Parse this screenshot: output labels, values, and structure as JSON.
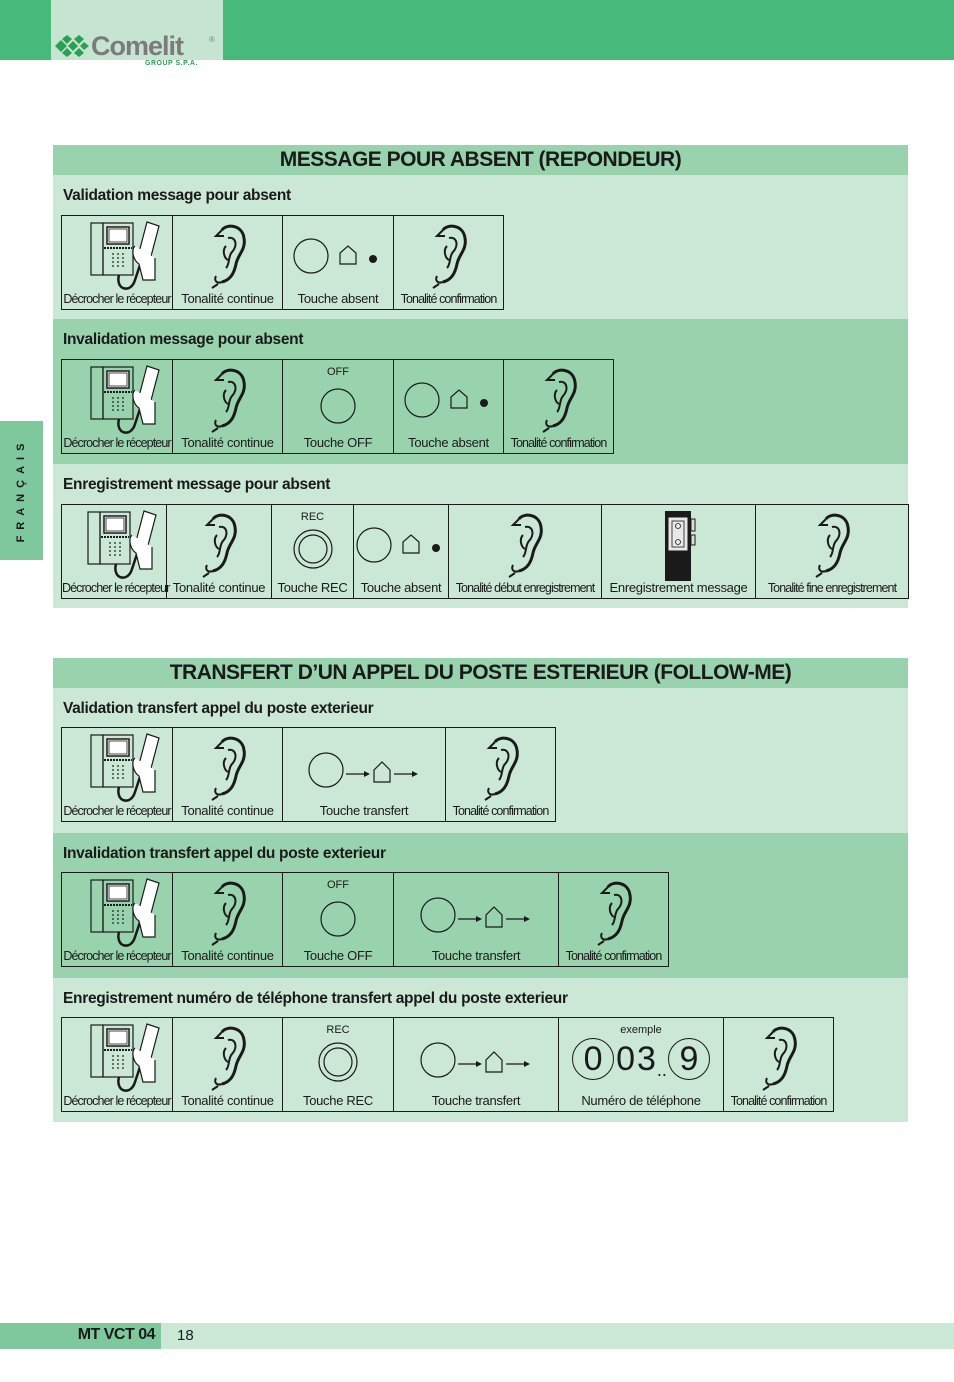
{
  "brand": {
    "name": "Comelit",
    "registered": "®",
    "group": "GROUP S.P.A.",
    "colors": {
      "top_bar": "#46b97b",
      "header_band": "#99d3ae",
      "light_band": "#cbe7d6",
      "side_tab": "#7fc89d"
    }
  },
  "language_tab": "FRANÇAIS",
  "sections": [
    {
      "title": "MESSAGE POUR ABSENT (REPONDEUR)",
      "subsections": [
        {
          "title": "Validation message pour absent",
          "steps": [
            {
              "icon": "phone-handset-icon",
              "label": "Décrocher le récepteur"
            },
            {
              "icon": "ear-icon",
              "label": "Tonalité continue"
            },
            {
              "icon": "absent-key-icon",
              "label": "Touche absent"
            },
            {
              "icon": "ear-icon",
              "label": "Tonalité confirmation"
            }
          ]
        },
        {
          "title": "Invalidation message pour absent",
          "steps": [
            {
              "icon": "phone-handset-icon",
              "label": "Décrocher le récepteur"
            },
            {
              "icon": "ear-icon",
              "label": "Tonalité continue"
            },
            {
              "icon": "off-key-icon",
              "top": "OFF",
              "label": "Touche OFF"
            },
            {
              "icon": "absent-key-icon",
              "label": "Touche absent"
            },
            {
              "icon": "ear-icon",
              "label": "Tonalité confirmation"
            }
          ]
        },
        {
          "title": "Enregistrement message pour absent",
          "steps": [
            {
              "icon": "phone-handset-icon",
              "label": "Décrocher le récepteur"
            },
            {
              "icon": "ear-icon",
              "label": "Tonalité continue"
            },
            {
              "icon": "rec-key-icon",
              "top": "REC",
              "label": "Touche REC"
            },
            {
              "icon": "absent-key-icon",
              "label": "Touche absent"
            },
            {
              "icon": "ear-icon",
              "label": "Tonalité début enregistrement"
            },
            {
              "icon": "recorder-icon",
              "label": "Enregistrement message"
            },
            {
              "icon": "ear-icon",
              "label": "Tonalité fine enregistrement"
            }
          ]
        }
      ]
    },
    {
      "title": "TRANSFERT D’UN APPEL DU POSTE ESTERIEUR (FOLLOW-ME)",
      "subsections": [
        {
          "title": "Validation transfert appel du poste exterieur",
          "steps": [
            {
              "icon": "phone-handset-icon",
              "label": "Décrocher le récepteur"
            },
            {
              "icon": "ear-icon",
              "label": "Tonalité continue"
            },
            {
              "icon": "transfer-key-icon",
              "label": "Touche transfert"
            },
            {
              "icon": "ear-icon",
              "label": "Tonalité confirmation"
            }
          ]
        },
        {
          "title": "Invalidation transfert appel du poste exterieur",
          "steps": [
            {
              "icon": "phone-handset-icon",
              "label": "Décrocher le récepteur"
            },
            {
              "icon": "ear-icon",
              "label": "Tonalité continue"
            },
            {
              "icon": "off-key-icon",
              "top": "OFF",
              "label": "Touche OFF"
            },
            {
              "icon": "transfer-key-icon",
              "label": "Touche transfert"
            },
            {
              "icon": "ear-icon",
              "label": "Tonalité confirmation"
            }
          ]
        },
        {
          "title": "Enregistrement numéro de téléphone transfert appel du poste exterieur",
          "steps": [
            {
              "icon": "phone-handset-icon",
              "label": "Décrocher le récepteur"
            },
            {
              "icon": "ear-icon",
              "label": "Tonalité continue"
            },
            {
              "icon": "rec-key-icon",
              "top": "REC",
              "label": "Touche REC"
            },
            {
              "icon": "transfer-key-icon",
              "label": "Touche transfert"
            },
            {
              "icon": "phone-number-icon",
              "top": "exemple",
              "digits": [
                "0",
                "0",
                "3",
                "..",
                "9"
              ],
              "label": "Numéro de téléphone"
            },
            {
              "icon": "ear-icon",
              "label": "Tonalité confirmation"
            }
          ]
        }
      ]
    }
  ],
  "footer": {
    "code": "MT VCT 04",
    "page": "18"
  }
}
